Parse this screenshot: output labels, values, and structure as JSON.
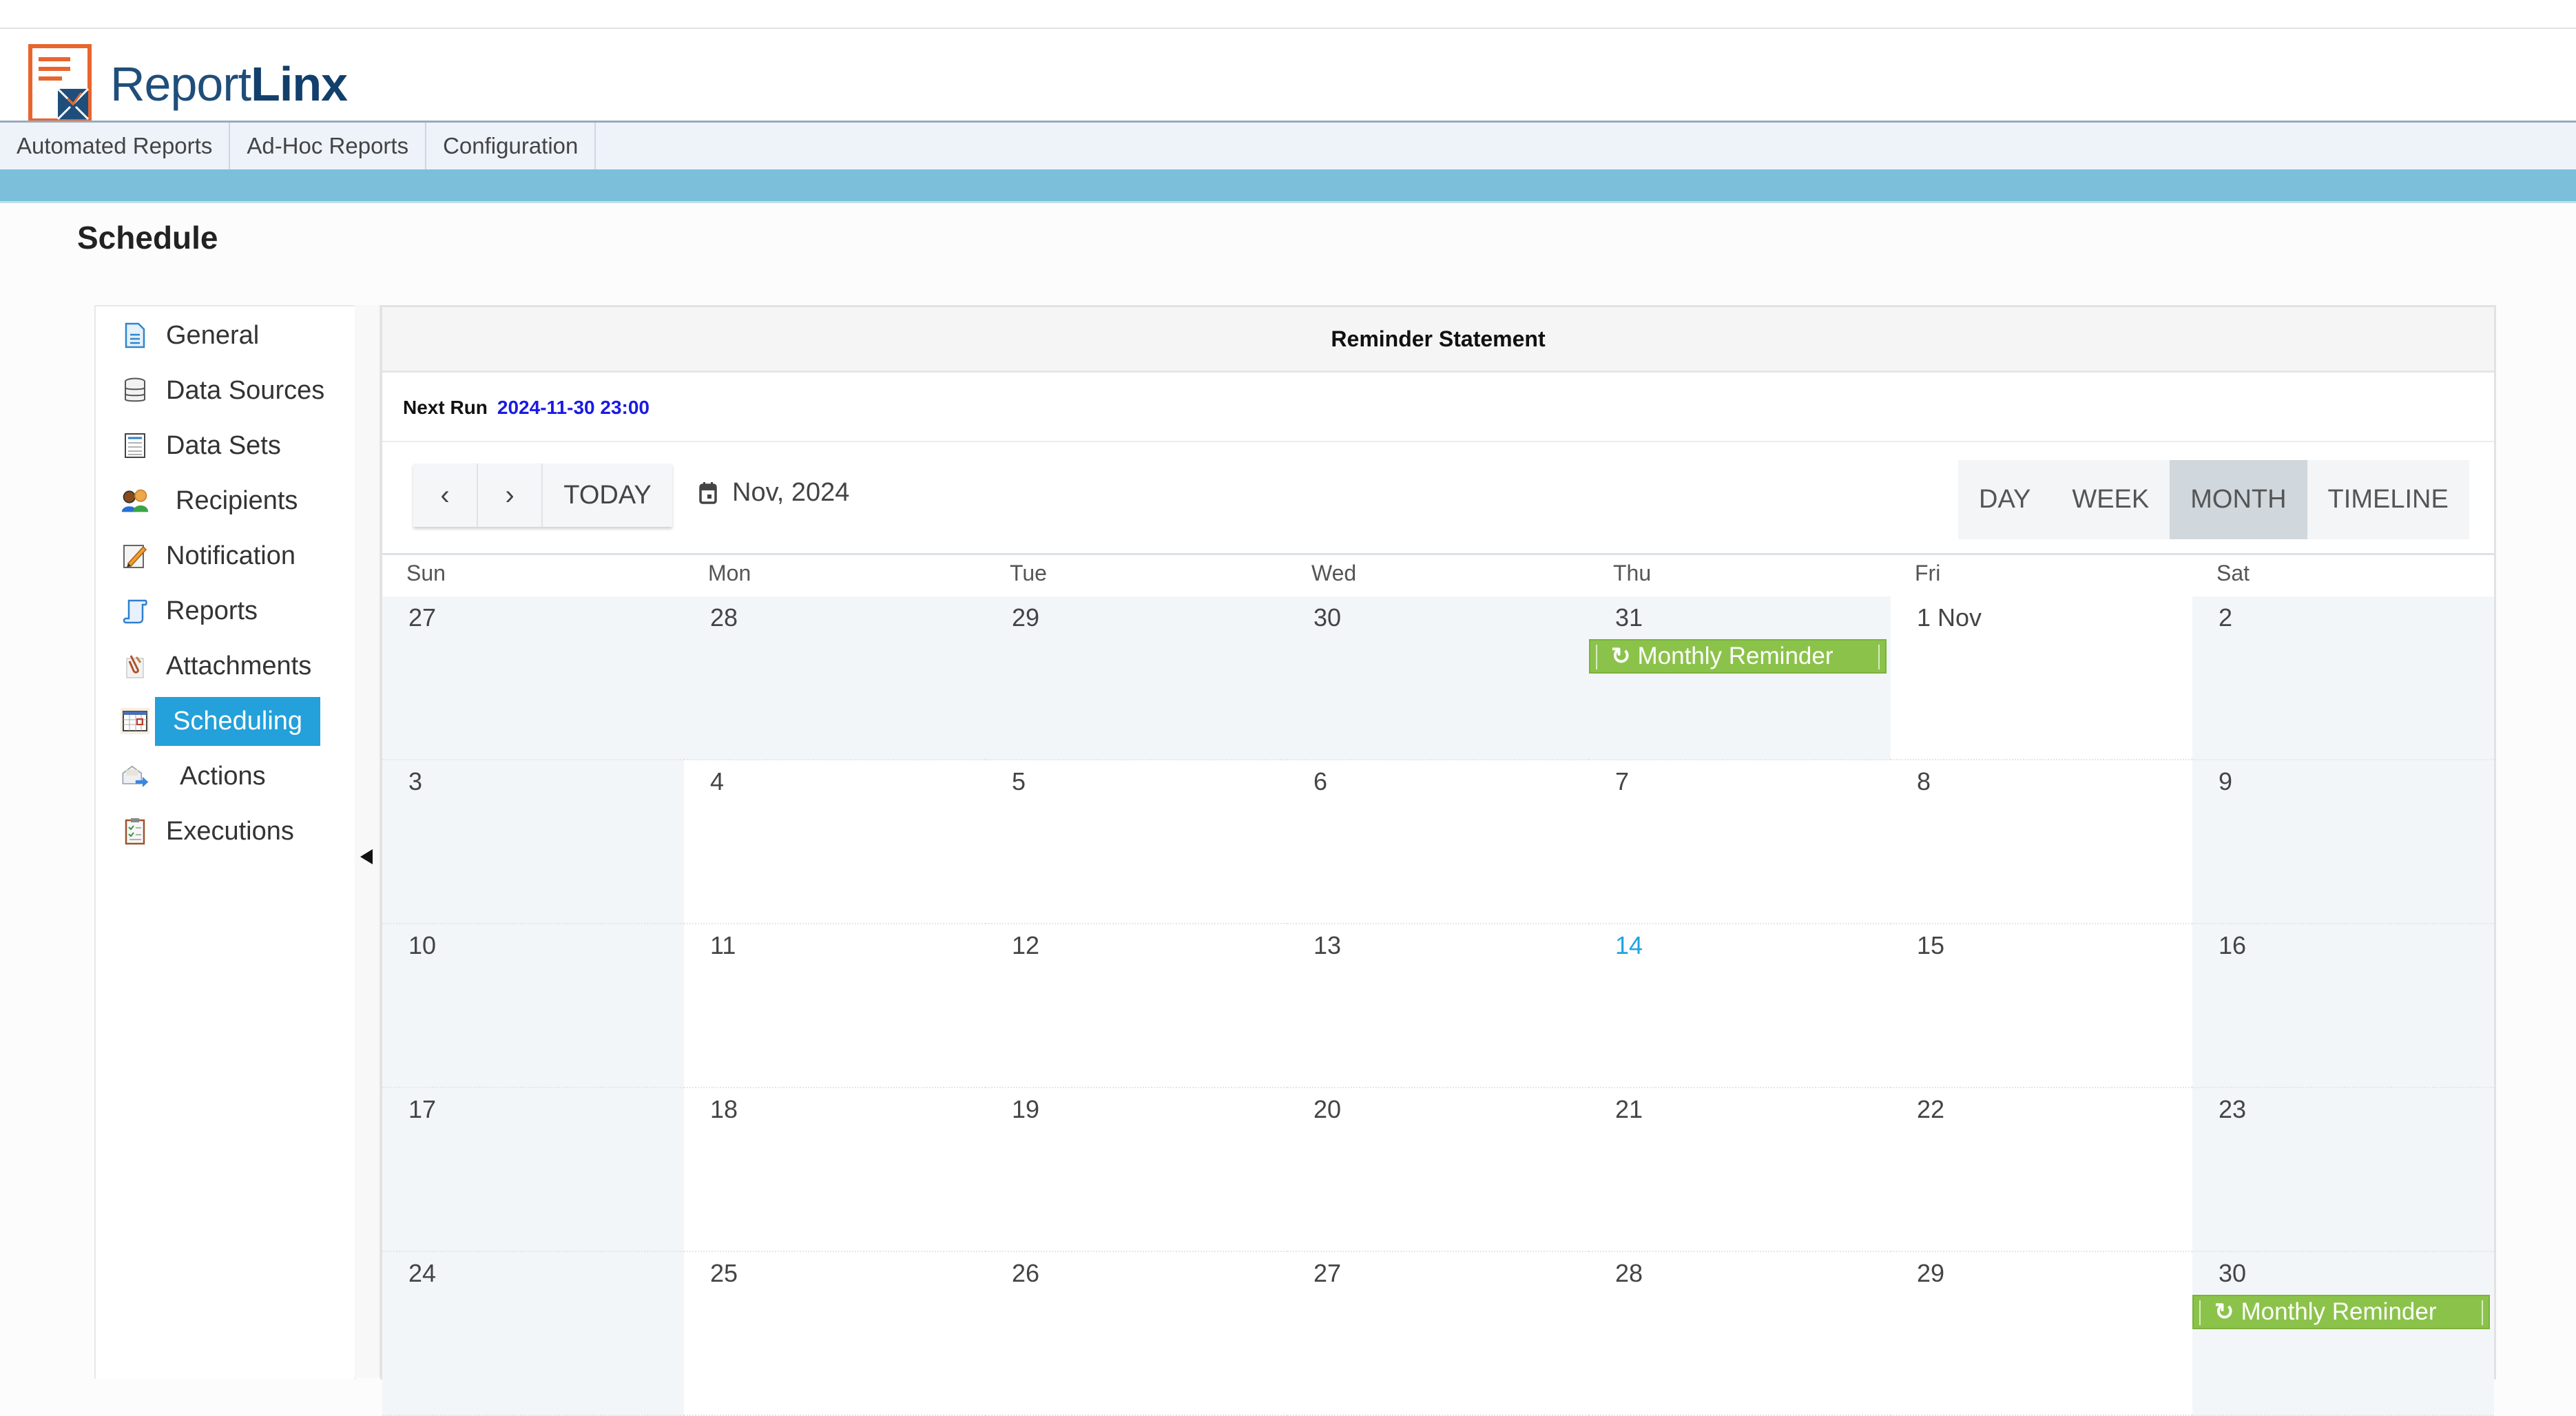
{
  "app": {
    "name_regular": "Report",
    "name_bold": "Linx"
  },
  "nav": {
    "items": [
      {
        "label": "Automated Reports"
      },
      {
        "label": "Ad-Hoc Reports"
      },
      {
        "label": "Configuration"
      }
    ]
  },
  "page": {
    "title": "Schedule"
  },
  "sidebar": {
    "items": [
      {
        "label": "General",
        "icon": "document-icon"
      },
      {
        "label": "Data Sources",
        "icon": "database-icon"
      },
      {
        "label": "Data Sets",
        "icon": "dataset-icon"
      },
      {
        "label": "Recipients",
        "icon": "users-icon"
      },
      {
        "label": "Notification",
        "icon": "edit-note-icon"
      },
      {
        "label": "Reports",
        "icon": "scroll-icon"
      },
      {
        "label": "Attachments",
        "icon": "paperclip-icon"
      },
      {
        "label": "Scheduling",
        "icon": "calendar-icon",
        "active": true
      },
      {
        "label": "Actions",
        "icon": "mail-forward-icon"
      },
      {
        "label": "Executions",
        "icon": "clipboard-check-icon"
      }
    ]
  },
  "schedule": {
    "title": "Reminder Statement",
    "next_run_label": "Next Run",
    "next_run_value": "2024-11-30 23:00"
  },
  "calendar": {
    "prev_label": "‹",
    "next_label": "›",
    "today_label": "TODAY",
    "current_period": "Nov, 2024",
    "views": [
      {
        "label": "DAY"
      },
      {
        "label": "WEEK"
      },
      {
        "label": "MONTH",
        "active": true
      },
      {
        "label": "TIMELINE"
      }
    ],
    "day_headers": [
      "Sun",
      "Mon",
      "Tue",
      "Wed",
      "Thu",
      "Fri",
      "Sat"
    ],
    "weeks": [
      [
        {
          "label": "27",
          "muted": true
        },
        {
          "label": "28",
          "muted": true
        },
        {
          "label": "29",
          "muted": true
        },
        {
          "label": "30",
          "muted": true
        },
        {
          "label": "31",
          "muted": true,
          "event": "Monthly Reminder"
        },
        {
          "label": "1 Nov"
        },
        {
          "label": "2",
          "muted": true
        }
      ],
      [
        {
          "label": "3",
          "muted": true
        },
        {
          "label": "4"
        },
        {
          "label": "5"
        },
        {
          "label": "6"
        },
        {
          "label": "7"
        },
        {
          "label": "8"
        },
        {
          "label": "9",
          "muted": true
        }
      ],
      [
        {
          "label": "10",
          "muted": true
        },
        {
          "label": "11"
        },
        {
          "label": "12"
        },
        {
          "label": "13"
        },
        {
          "label": "14",
          "today": true
        },
        {
          "label": "15"
        },
        {
          "label": "16",
          "muted": true
        }
      ],
      [
        {
          "label": "17",
          "muted": true
        },
        {
          "label": "18"
        },
        {
          "label": "19"
        },
        {
          "label": "20"
        },
        {
          "label": "21"
        },
        {
          "label": "22"
        },
        {
          "label": "23",
          "muted": true
        }
      ],
      [
        {
          "label": "24",
          "muted": true
        },
        {
          "label": "25"
        },
        {
          "label": "26"
        },
        {
          "label": "27"
        },
        {
          "label": "28"
        },
        {
          "label": "29"
        },
        {
          "label": "30",
          "muted": true,
          "event": "Monthly Reminder"
        }
      ]
    ],
    "event_icon": "↻"
  },
  "colors": {
    "accent_blue": "#24a0da",
    "event_green": "#8bc34a",
    "today_blue": "#1fa3e3",
    "next_run_blue": "#1a1ae6",
    "bluebar": "#7bbfda",
    "brand_navy": "#1f4e7a",
    "brand_orange": "#e8652e"
  }
}
